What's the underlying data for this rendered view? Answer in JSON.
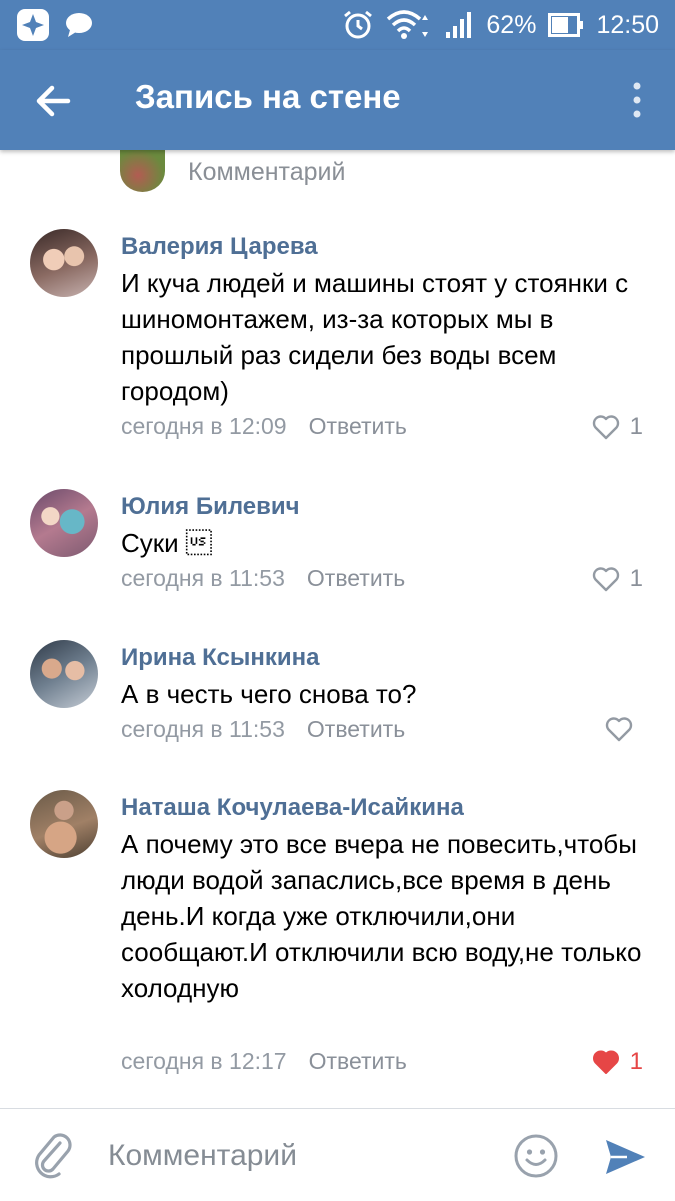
{
  "status_bar": {
    "battery_percent": "62%",
    "time": "12:50"
  },
  "header": {
    "title": "Запись на стене"
  },
  "top_comment_input": {
    "placeholder": "Комментарий"
  },
  "comments": [
    {
      "author": "Валерия Царева",
      "text": "И куча людей и машины стоят у стоянки с шиномонтажем, из-за которых мы в прошлый раз сидели без воды всем городом)",
      "time": "сегодня в 12:09",
      "reply_label": "Ответить",
      "likes": "1",
      "liked": false
    },
    {
      "author": "Юлия Билевич",
      "text": "Суки \u001f",
      "time": "сегодня в 11:53",
      "reply_label": "Ответить",
      "likes": "1",
      "liked": false
    },
    {
      "author": "Ирина Ксынкина",
      "text": "А в честь чего снова то?",
      "time": "сегодня в 11:53",
      "reply_label": "Ответить",
      "likes": "",
      "liked": false
    },
    {
      "author": "Наташа Кочулаева-Исайкина",
      "text": "А почему это все вчера не повесить,чтобы люди водой запаслись,все время в день день.И когда уже отключили,они сообщают.И отключили всю воду,не только холодную",
      "time": "сегодня в 12:17",
      "reply_label": "Ответить",
      "likes": "1",
      "liked": true
    }
  ],
  "bottom_bar": {
    "placeholder": "Комментарий"
  },
  "colors": {
    "header_bg": "#5181b8",
    "name_link": "#4f6f95",
    "like_active": "#e64646",
    "send_icon": "#5181b8"
  }
}
